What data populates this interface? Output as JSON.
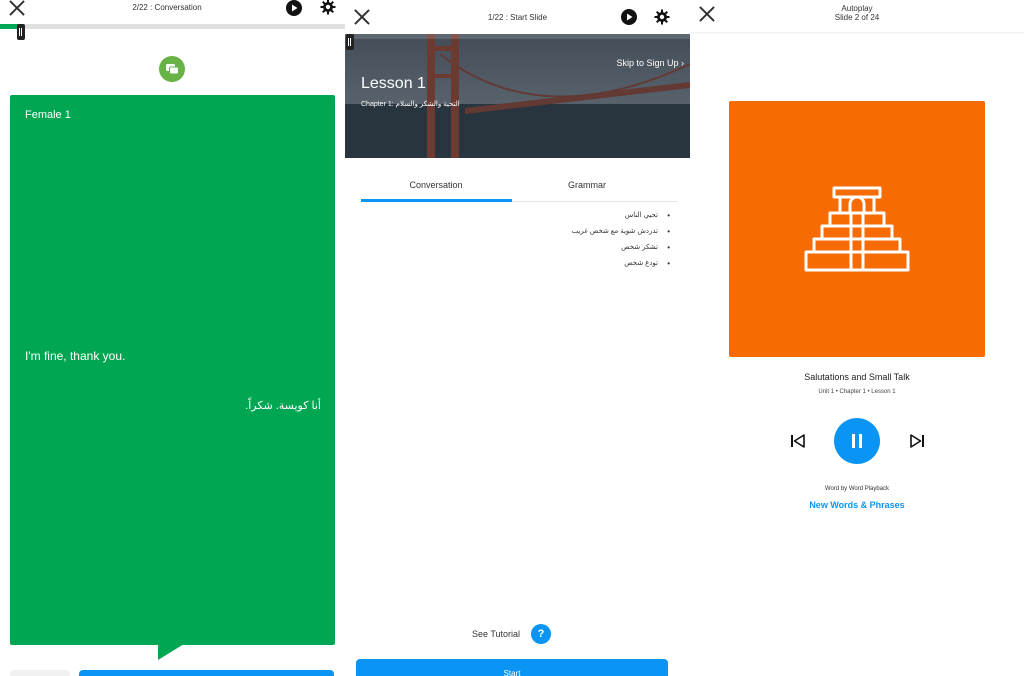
{
  "panel1": {
    "header_title": "2/22 : Conversation",
    "progress_fraction": 0.06,
    "speaker": "Female 1",
    "phrase_en": "I'm fine, thank you.",
    "phrase_ar": "أنا كويسة. شكراً."
  },
  "panel2": {
    "header_title": "1/22 : Start Slide",
    "lesson_title": "Lesson 1",
    "lesson_subtitle": "Chapter 1: التحية والشكر والسلام",
    "skip_label": "Skip to Sign Up",
    "tabs": [
      {
        "label": "Conversation",
        "active": true
      },
      {
        "label": "Grammar",
        "active": false
      }
    ],
    "topics": [
      "تحيي الناس",
      "تدردش شوية مع شخص غريب",
      "تشكر شخص",
      "تودع شخص"
    ],
    "tutorial_label": "See Tutorial",
    "help_glyph": "?",
    "start_label": "Start"
  },
  "panel3": {
    "header_line1": "Autoplay",
    "header_line2": "Slide 2 of 24",
    "card_color": "#f76b04",
    "title": "Salutations and Small Talk",
    "subtitle": "Unit 1 • Chapter 1 • Lesson 1",
    "word_playback": "Word by Word Playback",
    "link_label": "New Words & Phrases"
  },
  "colors": {
    "accent_blue": "#0a95f5",
    "bubble_green": "#00a651",
    "badge_green": "#67b346"
  }
}
